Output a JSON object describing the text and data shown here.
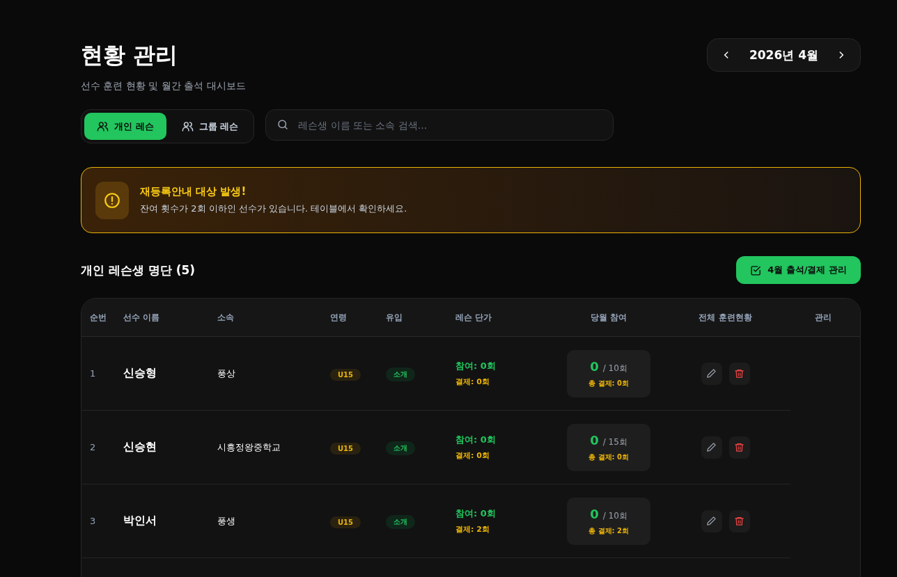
{
  "header": {
    "title": "현황 관리",
    "subtitle": "선수 훈련 현황 및 월간 출석 대시보드",
    "month": "2026년 4월"
  },
  "tabs": [
    {
      "label": "개인 레슨",
      "selected": true
    },
    {
      "label": "그룹 레슨",
      "selected": false
    }
  ],
  "search": {
    "placeholder": "레슨생 이름 또는 소속 검색..."
  },
  "alert": {
    "title": "재등록안내 대상 발생!",
    "message": "잔여 횟수가 2회 이하인 선수가 있습니다. 테이블에서 확인하세요."
  },
  "section": {
    "title": "개인 레슨생 명단 (5)",
    "action": "4월 출석/결제 관리"
  },
  "table": {
    "columns": [
      "순번",
      "선수 이름",
      "소속",
      "연령",
      "유입",
      "레슨 단가",
      "당월 참여",
      "전체 훈련현황",
      "관리"
    ],
    "rows": [
      {
        "no": "1",
        "name": "신승형",
        "team": "풍상",
        "age": "U15",
        "source": "소개",
        "attend": "참여: 0회",
        "paid": "결제: 0회",
        "count": "0",
        "total": "/ 10회",
        "total_paid": "총 결제: 0회"
      },
      {
        "no": "2",
        "name": "신승현",
        "team": "시흥정왕중학교",
        "age": "U15",
        "source": "소개",
        "attend": "참여: 0회",
        "paid": "결제: 0회",
        "count": "0",
        "total": "/ 15회",
        "total_paid": "총 결제: 0회"
      },
      {
        "no": "3",
        "name": "박인서",
        "team": "풍생",
        "age": "U15",
        "source": "소개",
        "attend": "참여: 0회",
        "paid": "결제: 2회",
        "count": "0",
        "total": "/ 10회",
        "total_paid": "총 결제: 2회"
      }
    ]
  }
}
